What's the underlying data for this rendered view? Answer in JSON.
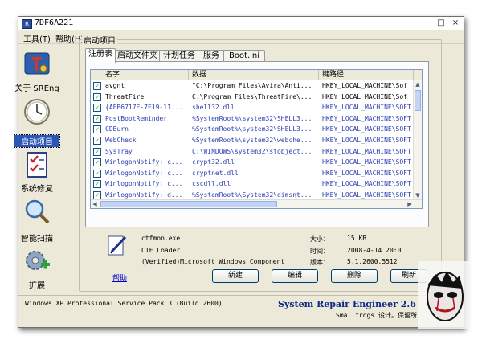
{
  "window": {
    "title": "7DF6A221",
    "app_icon": "R",
    "controls": [
      "minimize-icon",
      "maximize-icon",
      "close-icon"
    ]
  },
  "menu": {
    "tools": "工具(T)",
    "help": "帮助(H)"
  },
  "sidebar": {
    "items": [
      {
        "label": "关于 SREng",
        "icon": "sreng-logo-icon"
      },
      {
        "label": "启动项目",
        "icon": "clock-icon",
        "selected": true
      },
      {
        "label": "系统修复",
        "icon": "checklist-icon"
      },
      {
        "label": "智能扫描",
        "icon": "magnifier-icon"
      },
      {
        "label": "扩展",
        "icon": "gear-plus-icon"
      }
    ]
  },
  "group": {
    "title": "启动项目"
  },
  "tabs": [
    "注册表",
    "启动文件夹",
    "计划任务",
    "服务",
    "Boot.ini"
  ],
  "active_tab": 0,
  "list": {
    "columns": [
      "名字",
      "数据",
      "键路径"
    ],
    "rows": [
      {
        "checked": true,
        "name": "avgnt",
        "data": "\"C:\\Program Files\\Avira\\Anti...",
        "path": "HKEY_LOCAL_MACHINE\\Sof"
      },
      {
        "checked": true,
        "name": "ThreatFire",
        "data": "C:\\Program Files\\ThreatFire\\...",
        "path": "HKEY_LOCAL_MACHINE\\Sof"
      },
      {
        "checked": true,
        "name": "{AEB6717E-7E19-11...",
        "data": "shell32.dll",
        "path": "HKEY_LOCAL_MACHINE\\SOFT"
      },
      {
        "checked": true,
        "name": "PostBootReminder",
        "data": "%SystemRoot%\\system32\\SHELL3...",
        "path": "HKEY_LOCAL_MACHINE\\SOFT"
      },
      {
        "checked": true,
        "name": "CDBurn",
        "data": "%SystemRoot%\\system32\\SHELL3...",
        "path": "HKEY_LOCAL_MACHINE\\SOFT"
      },
      {
        "checked": true,
        "name": "WebCheck",
        "data": "%SystemRoot%\\system32\\webche...",
        "path": "HKEY_LOCAL_MACHINE\\SOFT"
      },
      {
        "checked": true,
        "name": "SysTray",
        "data": "C:\\WINDOWS\\system32\\stobject...",
        "path": "HKEY_LOCAL_MACHINE\\SOFT"
      },
      {
        "checked": true,
        "name": "WinlogonNotify: c...",
        "data": "crypt32.dll",
        "path": "HKEY_LOCAL_MACHINE\\SOFT"
      },
      {
        "checked": true,
        "name": "WinlogonNotify: c...",
        "data": "cryptnet.dll",
        "path": "HKEY_LOCAL_MACHINE\\SOFT"
      },
      {
        "checked": true,
        "name": "WinlogonNotify: c...",
        "data": "cscdll.dll",
        "path": "HKEY_LOCAL_MACHINE\\SOFT"
      },
      {
        "checked": true,
        "name": "WinlogonNotify: d...",
        "data": "%SystemRoot%\\System32\\dimsnt...",
        "path": "HKEY_LOCAL_MACHINE\\SOFT"
      }
    ]
  },
  "details": {
    "file": "ctfmon.exe",
    "description": "CTF Loader",
    "company": "(Verified)Microsoft Windows Component",
    "size_label": "大小：",
    "size_value": "15 KB",
    "time_label": "时间：",
    "time_value": "2008-4-14 20:0",
    "version_label": "版本：",
    "version_value": "5.1.2600.5512"
  },
  "buttons": {
    "help": "帮助",
    "new": "新建",
    "edit": "编辑",
    "delete": "删除",
    "refresh": "刷新"
  },
  "statusbar": {
    "os": "Windows XP Professional Service Pack 3 (Build 2600)",
    "product": "System Repair Engineer 2.6",
    "credit": "Smallfrogs 设计。保留所"
  },
  "colors": {
    "accent": "#2b56b8",
    "link": "#0000cc",
    "product": "#0b2a8a",
    "check": "#21a121"
  }
}
